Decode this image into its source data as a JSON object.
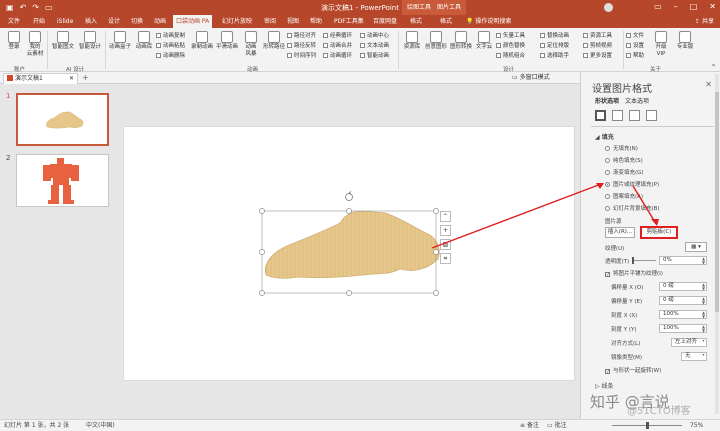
{
  "titlebar": {
    "title": "演示文稿1 - PowerPoint",
    "context_tab_1": "绘图工具",
    "context_tab_2": "图片工具",
    "user_name": "",
    "qat_icons": [
      "save-icon",
      "undo-icon",
      "redo-icon",
      "present-icon"
    ]
  },
  "tabs": [
    "文件",
    "开始",
    "iSlide",
    "插入",
    "设计",
    "切换",
    "动画",
    "口袋动画 PA",
    "幻灯片放映",
    "审阅",
    "视图",
    "帮助",
    "PDF工具集",
    "百度网盘",
    "格式",
    "格式"
  ],
  "active_tab_index": 7,
  "tell_me": "操作说明搜索",
  "share": "共享",
  "ribbon": {
    "login": "登录",
    "cloud": "我的\n云素材",
    "group_account": "账户",
    "smart_text": "智能图文",
    "smart_design": "智能设计",
    "group_ai": "AI 设计",
    "anim_box": "动画盒子",
    "anim_lib": "动画库",
    "anim_copy": "动画复制",
    "anim_paste": "动画粘贴",
    "anim_delete": "动画删除",
    "record_anim": "录制动画",
    "smooth_anim": "平滑动画",
    "anim_style": "动画\n风暴",
    "path_shape": "形转路径",
    "path_align": "路径对齐",
    "path_reverse": "路径反转",
    "time_seq": "时间序列",
    "classic_loop": "经典循环",
    "anim_merge": "动画合并",
    "anim_loop": "动画循环",
    "anim_center": "动画中心",
    "text_anim": "文本动画",
    "smart_anim": "智能动画",
    "group_anim": "动画",
    "resource": "资源库",
    "creative_img": "创意图形",
    "img_convert": "图形转换",
    "text_cloud": "文字云",
    "shape_tools": "矢量工具",
    "color_replace": "颜色替换",
    "random_combo": "随机组合",
    "batch_replace": "替换动画",
    "position_align": "定位排版",
    "select_assist": "选择助手",
    "resource_tools": "资源工具",
    "cut_frames": "剪帧视频",
    "more_settings": "更多设置",
    "group_design": "设计",
    "file": "文件",
    "settings": "设置",
    "help": "帮助",
    "vip": "升级\nVIP",
    "pro": "专业版",
    "group_about": "关于"
  },
  "doc_tab": "演示文稿1",
  "multi_window": "多窗口模式",
  "thumbnails": [
    {
      "number": "1"
    },
    {
      "number": "2"
    }
  ],
  "pane": {
    "title": "设置图片格式",
    "tab_shape": "形状选项",
    "tab_text": "文本选项",
    "section_fill": "填充",
    "fill_options": [
      {
        "label": "无填充(N)",
        "checked": false
      },
      {
        "label": "纯色填充(S)",
        "checked": false
      },
      {
        "label": "渐变填充(G)",
        "checked": false
      },
      {
        "label": "图片或纹理填充(P)",
        "checked": true
      },
      {
        "label": "图案填充(A)",
        "checked": false
      },
      {
        "label": "幻灯片背景填充(B)",
        "checked": false
      }
    ],
    "picture_source": "图片源",
    "insert_btn": "插入(R)...",
    "clipboard_btn": "剪贴板(C)",
    "texture_label": "纹理(U)",
    "transparency_label": "透明度(T)",
    "transparency_value": "0%",
    "tile_checkbox": "将图片平铺为纹理(I)",
    "offset_x_label": "偏移量 X (O)",
    "offset_x_value": "0 磅",
    "offset_y_label": "偏移量 Y (E)",
    "offset_y_value": "0 磅",
    "scale_x_label": "刻度 X (X)",
    "scale_x_value": "100%",
    "scale_y_label": "刻度 Y (Y)",
    "scale_y_value": "100%",
    "align_label": "对齐方式(L)",
    "align_value": "左上对齐",
    "mirror_label": "镜像类型(M)",
    "mirror_value": "无",
    "rotate_checkbox": "与形状一起旋转(W)",
    "section_line": "线条"
  },
  "status": {
    "slide_info": "幻灯片 第 1 张，共 2 张",
    "language": "中文(中国)",
    "notes": "备注",
    "comments": "批注",
    "zoom": "75%"
  },
  "watermark": {
    "line1": "知乎 @言说",
    "line2": "@51CTO博客"
  },
  "colors": {
    "accent": "#b7472a",
    "texture": "#e6c689",
    "robot": "#e8623f",
    "highlight": "#e02020"
  }
}
